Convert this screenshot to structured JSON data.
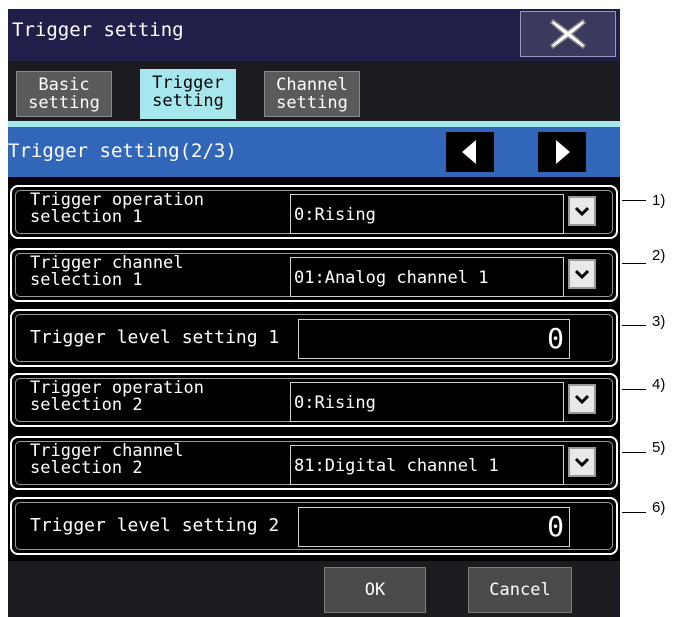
{
  "window": {
    "title": "Trigger setting",
    "close_icon": "close-x-icon"
  },
  "tabs": [
    {
      "line1": "Basic",
      "line2": "setting",
      "active": false
    },
    {
      "line1": "Trigger",
      "line2": "setting",
      "active": true
    },
    {
      "line1": "Channel",
      "line2": "setting",
      "active": false
    }
  ],
  "page": {
    "title": "Trigger setting(2/3)",
    "prev_icon": "triangle-left-icon",
    "next_icon": "triangle-right-icon"
  },
  "rows": [
    {
      "label1": "Trigger operation",
      "label2": "selection 1",
      "value": "0:Rising",
      "callout": "1)"
    },
    {
      "label1": "Trigger channel",
      "label2": "selection 1",
      "value": "01:Analog channel 1",
      "callout": "2)"
    },
    {
      "label": "Trigger level setting 1",
      "value": "0",
      "callout": "3)"
    },
    {
      "label1": "Trigger operation",
      "label2": "selection 2",
      "value": "0:Rising",
      "callout": "4)"
    },
    {
      "label1": "Trigger channel",
      "label2": "selection 2",
      "value": "81:Digital channel 1",
      "callout": "5)"
    },
    {
      "label": "Trigger level setting 2",
      "value": "0",
      "callout": "6)"
    }
  ],
  "footer": {
    "ok_label": "OK",
    "cancel_label": "Cancel"
  },
  "colors": {
    "title_bg": "#1f1f4a",
    "tab_active": "#a6e7ee",
    "page_bar": "#3166b8",
    "panel_bg": "#000000"
  }
}
